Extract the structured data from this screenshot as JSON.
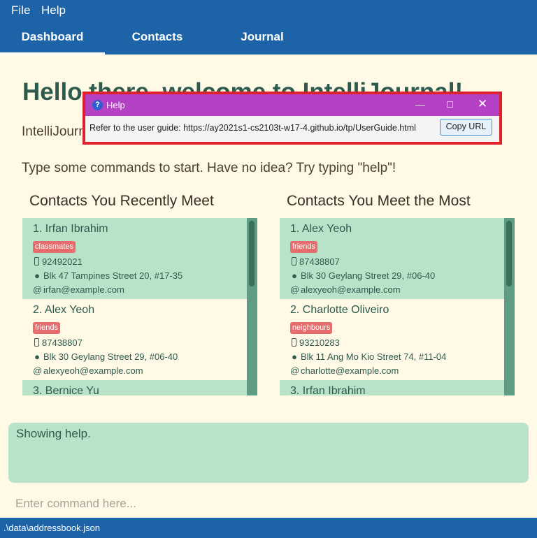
{
  "menu": {
    "file": "File",
    "help": "Help"
  },
  "tabs": [
    "Dashboard",
    "Contacts",
    "Journal"
  ],
  "dashboard": {
    "greeting": "Hello there, welcome to IntelliJournal!",
    "intro": "IntelliJournal helps you keep track of the people you meet.",
    "hint": "Type some commands to start. Have no idea? Try typing \"help\"!"
  },
  "recent": {
    "title": "Contacts You Recently Meet",
    "contacts": [
      {
        "name": "1.  Irfan Ibrahim",
        "tag": "classmates",
        "phone": "92492021",
        "address": "Blk 47 Tampines Street 20, #17-35",
        "email": "irfan@example.com"
      },
      {
        "name": "2.  Alex Yeoh",
        "tag": "friends",
        "phone": "87438807",
        "address": "Blk 30 Geylang Street 29, #06-40",
        "email": "alexyeoh@example.com"
      },
      {
        "name": "3.  Bernice Yu"
      }
    ]
  },
  "most": {
    "title": "Contacts You Meet the Most",
    "contacts": [
      {
        "name": "1.  Alex Yeoh",
        "tag": "friends",
        "phone": "87438807",
        "address": "Blk 30 Geylang Street 29, #06-40",
        "email": "alexyeoh@example.com"
      },
      {
        "name": "2.  Charlotte Oliveiro",
        "tag": "neighbours",
        "phone": "93210283",
        "address": "Blk 11 Ang Mo Kio Street 74, #11-04",
        "email": "charlotte@example.com"
      },
      {
        "name": "3.  Irfan Ibrahim"
      }
    ]
  },
  "result": "Showing help.",
  "command": {
    "placeholder": "Enter command here..."
  },
  "status": ".\\data\\addressbook.json",
  "help_dialog": {
    "title": "Help",
    "message": "Refer to the user guide: https://ay2021s1-cs2103t-w17-4.github.io/tp/UserGuide.html",
    "copy_button": "Copy URL",
    "minimize": "—",
    "close": "✕"
  },
  "icons": {
    "email": "@",
    "address": "location-pin-icon",
    "phone": "phone-icon"
  },
  "colors": {
    "primary": "#1d63a8",
    "card": "#b9e3c9",
    "tag": "#e66d6d",
    "dialog_title": "#b440c4",
    "highlight": "#e0212c"
  }
}
